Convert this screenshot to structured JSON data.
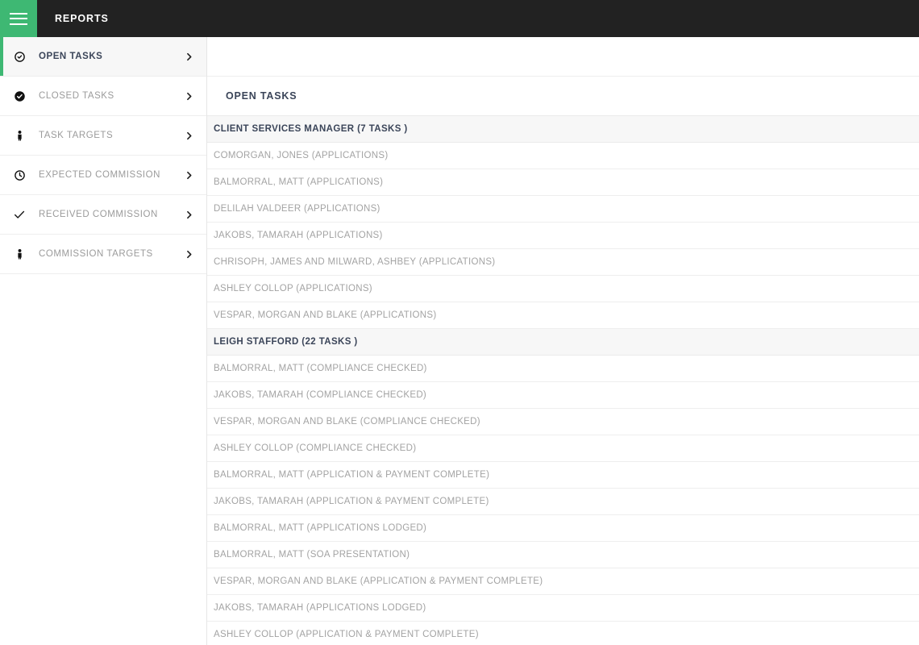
{
  "topbar": {
    "menu_icon": "hamburger-icon",
    "title": "REPORTS"
  },
  "sidebar": {
    "items": [
      {
        "label": "OPEN TASKS",
        "icon": "circle-check-outline-icon",
        "active": true,
        "chevron": "chevron-right-icon"
      },
      {
        "label": "CLOSED TASKS",
        "icon": "circle-check-filled-icon",
        "active": false,
        "chevron": "chevron-right-icon"
      },
      {
        "label": "TASK TARGETS",
        "icon": "person-icon",
        "active": false,
        "chevron": "chevron-right-icon"
      },
      {
        "label": "EXPECTED COMMISSION",
        "icon": "clock-icon",
        "active": false,
        "chevron": "chevron-right-icon"
      },
      {
        "label": "RECEIVED COMMISSION",
        "icon": "check-icon",
        "active": false,
        "chevron": "chevron-right-icon"
      },
      {
        "label": "COMMISSION TARGETS",
        "icon": "person-icon",
        "active": false,
        "chevron": "chevron-right-icon"
      }
    ]
  },
  "main": {
    "panel_title": "OPEN TASKS",
    "groups": [
      {
        "header": "CLIENT SERVICES MANAGER (7 TASKS )",
        "tasks": [
          "COMORGAN, JONES (APPLICATIONS)",
          "BALMORRAL, MATT (APPLICATIONS)",
          "DELILAH VALDEER (APPLICATIONS)",
          "JAKOBS, TAMARAH (APPLICATIONS)",
          "CHRISOPH, JAMES AND MILWARD, ASHBEY (APPLICATIONS)",
          "ASHLEY COLLOP (APPLICATIONS)",
          "VESPAR, MORGAN AND BLAKE (APPLICATIONS)"
        ]
      },
      {
        "header": "LEIGH STAFFORD (22 TASKS )",
        "tasks": [
          "BALMORRAL, MATT (COMPLIANCE CHECKED)",
          "JAKOBS, TAMARAH (COMPLIANCE CHECKED)",
          "VESPAR, MORGAN AND BLAKE (COMPLIANCE CHECKED)",
          "ASHLEY COLLOP (COMPLIANCE CHECKED)",
          "BALMORRAL, MATT (APPLICATION & PAYMENT COMPLETE)",
          "JAKOBS, TAMARAH (APPLICATION & PAYMENT COMPLETE)",
          "BALMORRAL, MATT (APPLICATIONS LODGED)",
          "BALMORRAL, MATT (SOA PRESENTATION)",
          "VESPAR, MORGAN AND BLAKE (APPLICATION & PAYMENT COMPLETE)",
          "JAKOBS, TAMARAH (APPLICATIONS LODGED)",
          "ASHLEY COLLOP (APPLICATION & PAYMENT COMPLETE)"
        ]
      }
    ]
  },
  "colors": {
    "accent_green": "#3eb873",
    "topbar_dark": "#222222",
    "group_header_bg": "#f7f7f7",
    "row_text": "#a3a3a3",
    "heading_text": "#3b4559"
  }
}
